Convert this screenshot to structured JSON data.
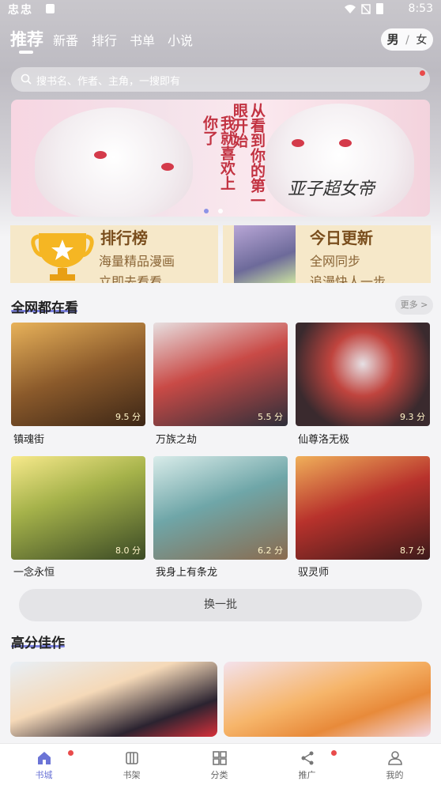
{
  "status_bar": {
    "left_icons": "忠忠",
    "time": "8:53"
  },
  "tabs": [
    {
      "label": "推荐"
    },
    {
      "label": "新番"
    },
    {
      "label": "排行"
    },
    {
      "label": "书单"
    },
    {
      "label": "小说"
    }
  ],
  "gender": {
    "male": "男",
    "sep": "/",
    "female": "女"
  },
  "search": {
    "placeholder": "搜书名、作者、主角，一搜即有"
  },
  "banner": {
    "text_col1": "从看到你的第一眼开始",
    "text_col2": "我就喜欢上你了",
    "signature": "亚子超女帝"
  },
  "promo": [
    {
      "title": "排行榜",
      "line1": "海量精品漫画",
      "line2": "立即去看看"
    },
    {
      "title": "今日更新",
      "line1": "全网同步",
      "line2": "追漫快人一步"
    }
  ],
  "section_watching": {
    "title": "全网都在看",
    "more": "更多 >"
  },
  "comics": [
    {
      "title": "镇魂街",
      "score": "9.5 分",
      "color": "#8b5a2b"
    },
    {
      "title": "万族之劫",
      "score": "5.5 分",
      "color": "#c94a46"
    },
    {
      "title": "仙尊洛无极",
      "score": "9.3 分",
      "color": "#3a2a2e"
    },
    {
      "title": "一念永恒",
      "score": "8.0 分",
      "color": "#3b4a25"
    },
    {
      "title": "我身上有条龙",
      "score": "6.2 分",
      "color": "#6fa6a8"
    },
    {
      "title": "驭灵师",
      "score": "8.7 分",
      "color": "#b8322c"
    }
  ],
  "swap_button": "换一批",
  "section_high": {
    "title": "高分佳作"
  },
  "bottom_nav": [
    {
      "label": "书城",
      "active": true,
      "badge": true
    },
    {
      "label": "书架",
      "active": false,
      "badge": false
    },
    {
      "label": "分类",
      "active": false,
      "badge": false
    },
    {
      "label": "推广",
      "active": false,
      "badge": true
    },
    {
      "label": "我的",
      "active": false,
      "badge": false
    }
  ],
  "colors": {
    "accent": "#6b74d6",
    "badge": "#e94b4b"
  }
}
